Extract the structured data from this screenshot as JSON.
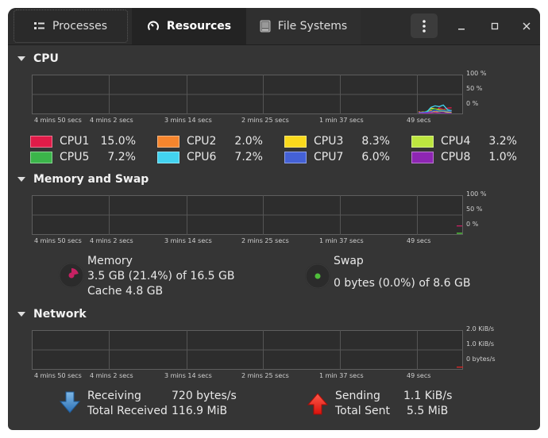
{
  "tabs": [
    {
      "label": "Processes",
      "icon": "list-icon"
    },
    {
      "label": "Resources",
      "icon": "gauge-icon",
      "active": true
    },
    {
      "label": "File Systems",
      "icon": "disk-icon"
    }
  ],
  "window_controls": {
    "menu": "main-menu",
    "minimize": "minimize",
    "maximize": "maximize",
    "close": "close"
  },
  "cpu": {
    "title": "CPU",
    "y_labels": [
      "100 %",
      "50 %",
      "0 %"
    ],
    "x_labels": [
      "4 mins 50 secs",
      "4 mins 2 secs",
      "3 mins 14 secs",
      "2 mins 25 secs",
      "1 min 37 secs",
      "49 secs"
    ],
    "cores": [
      {
        "name": "CPU1",
        "value": "15.0%",
        "color": "#e01b48"
      },
      {
        "name": "CPU2",
        "value": "2.0%",
        "color": "#f6852d"
      },
      {
        "name": "CPU3",
        "value": "8.3%",
        "color": "#fad91c"
      },
      {
        "name": "CPU4",
        "value": "3.2%",
        "color": "#bde63f"
      },
      {
        "name": "CPU5",
        "value": "7.2%",
        "color": "#3bb54a"
      },
      {
        "name": "CPU6",
        "value": "7.2%",
        "color": "#42d3f0"
      },
      {
        "name": "CPU7",
        "value": "6.0%",
        "color": "#4461d6"
      },
      {
        "name": "CPU8",
        "value": "1.0%",
        "color": "#8e26b3"
      }
    ]
  },
  "memory": {
    "title": "Memory and Swap",
    "y_labels": [
      "100 %",
      "50 %",
      "0 %"
    ],
    "x_labels": [
      "4 mins 50 secs",
      "4 mins 2 secs",
      "3 mins 14 secs",
      "2 mins 25 secs",
      "1 min 37 secs",
      "49 secs"
    ],
    "memory_label": "Memory",
    "memory_usage": "3.5 GB (21.4%) of 16.5 GB",
    "memory_cache": "Cache 4.8 GB",
    "memory_percent": 21.4,
    "memory_color": "#c72163",
    "swap_label": "Swap",
    "swap_usage": "0 bytes (0.0%) of 8.6 GB",
    "swap_percent": 0.0,
    "swap_color": "#4fbe3a"
  },
  "network": {
    "title": "Network",
    "y_labels": [
      "2.0 KiB/s",
      "1.0 KiB/s",
      "0 bytes/s"
    ],
    "x_labels": [
      "4 mins 50 secs",
      "4 mins 2 secs",
      "3 mins 14 secs",
      "2 mins 25 secs",
      "1 min 37 secs",
      "49 secs"
    ],
    "receiving_label": "Receiving",
    "receiving_value": "720 bytes/s",
    "total_received_label": "Total Received",
    "total_received_value": "116.9 MiB",
    "sending_label": "Sending",
    "sending_value": "1.1 KiB/s",
    "total_sent_label": "Total Sent",
    "total_sent_value": "5.5 MiB",
    "receiving_color": "#3d84c6",
    "sending_color": "#e0201b"
  }
}
